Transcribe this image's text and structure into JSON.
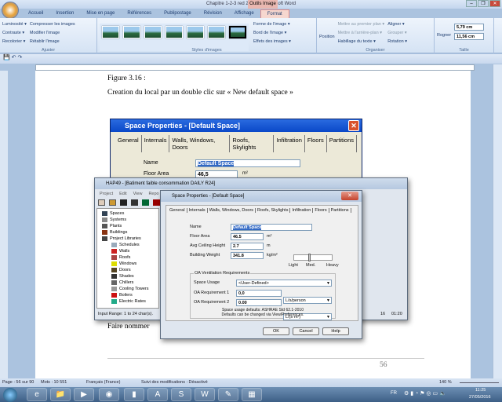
{
  "window": {
    "title": "Chapitre 1-2-3 red 27 mai - Microsoft Word",
    "context_tab": "Outils Image"
  },
  "ribbon": {
    "tabs": [
      "Accueil",
      "Insertion",
      "Mise en page",
      "Références",
      "Publipostage",
      "Révision",
      "Affichage",
      "Format"
    ],
    "active_tab": "Format",
    "ajuster": {
      "label": "Ajuster",
      "items": [
        "Luminosité ▾",
        "Contraste ▾",
        "Recolorier ▾",
        "Compresser les images",
        "Modifier l'image",
        "Rétablir l'image"
      ]
    },
    "styles": {
      "label": "Styles d'images",
      "items": [
        "Forme de l'image ▾",
        "Bord de l'image ▾",
        "Effets des images ▾"
      ]
    },
    "organiser": {
      "label": "Organiser",
      "position": "Position",
      "items": [
        "Mettre au premier plan ▾",
        "Mettre à l'arrière-plan ▾",
        "Habillage du texte ▾",
        "Aligner ▾",
        "Grouper ▾",
        "Rotation ▾"
      ]
    },
    "taille": {
      "label": "Taille",
      "rogner": "Rogner",
      "height": "5,79 cm",
      "width": "11,56 cm"
    }
  },
  "document": {
    "figure_label": "Figure 3.16 :",
    "caption": "Creation du local par un double clic sur « New default space »",
    "after_text": "Faire nommer",
    "page_number": "56"
  },
  "dialog_back": {
    "title": "Space Properties - [Default Space]",
    "tabs": [
      "General",
      "Internals",
      "Walls, Windows, Doors",
      "Roofs, Skylights",
      "Infiltration",
      "Floors",
      "Partitions"
    ],
    "name_label": "Name",
    "name_value": "Default Space",
    "floor_area_label": "Floor Area",
    "floor_area_value": "46,5",
    "floor_area_unit": "m²"
  },
  "hap": {
    "title": "HAP49 - [Batiment faible  consommation DAILY R24]",
    "menu": [
      "Project",
      "Edit",
      "View",
      "Repo"
    ],
    "tree": [
      "Spaces",
      "Systems",
      "Plants",
      "Buildings",
      "Project Libraries",
      "Schedules",
      "Walls",
      "Roofs",
      "Windows",
      "Doors",
      "Shades",
      "Chillers",
      "Cooling Towers",
      "Boilers",
      "Electric Rates"
    ],
    "status": "Input Range: 1 to 24 char(s).",
    "status_right": [
      "16",
      "01:20"
    ]
  },
  "dialog": {
    "title": "Space Properties - [Default Space]",
    "tabs": [
      "General",
      "Internals",
      "Walls, Windows, Doors",
      "Roofs, Skylights",
      "Infiltration",
      "Floors",
      "Partitions"
    ],
    "name_label": "Name",
    "name_value": "Default Space",
    "floor_area_label": "Floor Area",
    "floor_area_value": "46.5",
    "floor_area_unit": "m²",
    "ceiling_label": "Avg Ceiling Height",
    "ceiling_value": "2.7",
    "ceiling_unit": "m",
    "weight_label": "Building Weight",
    "weight_value": "341.8",
    "weight_unit": "kg/m²",
    "weight_scale": [
      "Light",
      "Med.",
      "Heavy"
    ],
    "oa_group": "OA Ventilation Requirements",
    "space_usage_label": "Space Usage",
    "space_usage_value": "<User-Defined>",
    "oa1_label": "OA Requirement 1",
    "oa1_value": "0,0",
    "oa1_unit": "L/s/person",
    "oa2_label": "OA Requirement 2",
    "oa2_value": "0.00",
    "oa2_unit": "L/(s·m²)",
    "note1": "Space usage defaults: ASHRAE Std 62.1-2010",
    "note2": "Defaults can be changed via View/Preferences.",
    "ok": "OK",
    "cancel": "Cancel",
    "help": "Help"
  },
  "statusbar": {
    "page": "Page : 56 sur 90",
    "words": "Mots : 10 551",
    "language": "Français (France)",
    "track": "Suivi des modifications : Désactivé",
    "zoom": "140 %"
  },
  "taskbar": {
    "lang": "FR",
    "time": "11:25",
    "date": "27/05/2016"
  }
}
